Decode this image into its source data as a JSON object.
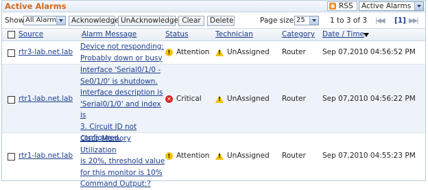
{
  "header": {
    "title": "Active Alarms",
    "rss_label": "RSS",
    "view_selected": "Active Alarms"
  },
  "toolbar": {
    "show_label": "Show",
    "show_selected": "All Alarms",
    "acknowledge": "Acknowledge",
    "unacknowledge": "UnAcknowledge",
    "clear": "Clear",
    "delete": "Delete",
    "page_size_label": "Page size",
    "page_size_selected": "25",
    "range_text": "1 to 3 of 3",
    "current_page": "[1]"
  },
  "columns": {
    "source": "Source",
    "message": "Alarm Message",
    "status": "Status",
    "technician": "Technician",
    "category": "Category",
    "datetime": "Date / Time"
  },
  "rows": [
    {
      "source": "rtr3-lab.net.lab",
      "message_lines": [
        "Device not responding:",
        "Probably down or busy"
      ],
      "status": "Attention",
      "status_level": "attention",
      "technician": "UnAssigned",
      "category": "Router",
      "datetime": "Sep 07,2010 04:56:52 PM"
    },
    {
      "source": "rtr1-lab.net.lab",
      "message_lines": [
        "Interface 'Serial0/1/0 -",
        "Se0/1/0' is shutdown.",
        "Interface description is",
        "'Serial0/1/0' and index is",
        "3. Circuit ID not",
        "configured."
      ],
      "status": "Critical",
      "status_level": "critical",
      "technician": "UnAssigned",
      "category": "Router",
      "datetime": "Sep 07,2010 04:56:22 PM"
    },
    {
      "source": "rtr1-lab.net.lab",
      "message_lines": [
        "Cisco Memory Utilization",
        "is 20%, threshold value",
        "for this monitor is 10%",
        "Command Output:?"
      ],
      "status": "Attention",
      "status_level": "attention",
      "technician": "UnAssigned",
      "category": "Router",
      "datetime": "Sep 07,2010 04:55:23 PM"
    }
  ],
  "colors": {
    "title": "#d2691e",
    "link": "#1a3c8c",
    "attention": "#f5c400",
    "critical": "#d9241c",
    "alt_row": "#eef3f9"
  },
  "icons": {
    "rss": "rss-feed-icon",
    "attention": "exclamation-circle-icon",
    "critical": "x-circle-icon",
    "technician": "warning-triangle-icon",
    "first": "first-page-icon",
    "last": "last-page-icon",
    "sort": "sort-descending-icon"
  }
}
